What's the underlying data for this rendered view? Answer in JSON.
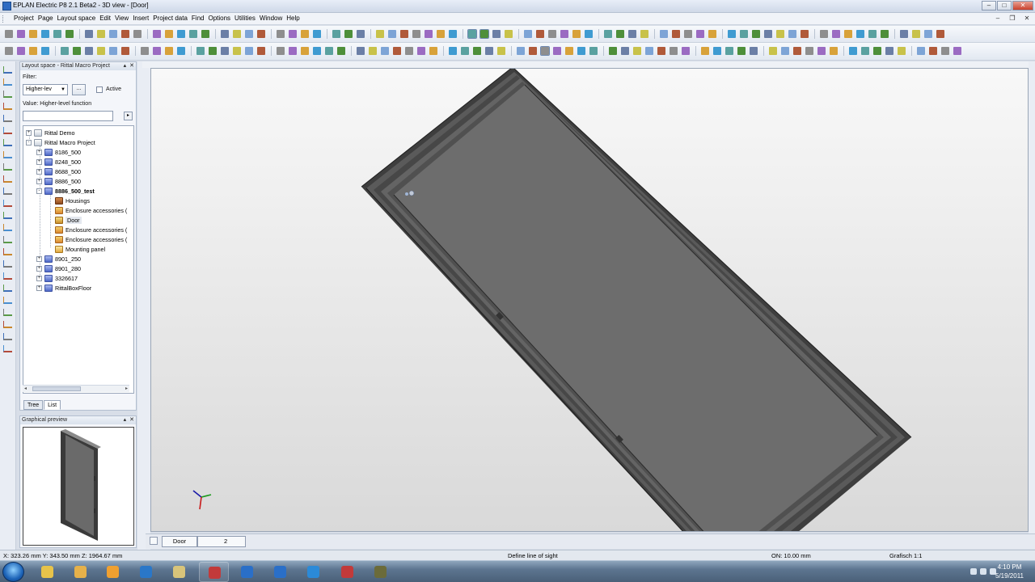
{
  "window": {
    "title": "EPLAN Electric P8 2.1 Beta2 - 3D view - [Door]"
  },
  "menu": [
    "Project",
    "Page",
    "Layout space",
    "Edit",
    "View",
    "Insert",
    "Project data",
    "Find",
    "Options",
    "Utilities",
    "Window",
    "Help"
  ],
  "layout_panel": {
    "title": "Layout space - Rittal Macro Project",
    "filter_label": "Filter:",
    "filter_value": "Higher-lev",
    "ellipsis_label": "...",
    "active_label": "Active",
    "value_label": "Value: Higher-level function",
    "tree": [
      {
        "label": "Rittal Demo",
        "level": 0,
        "icon": "project-icon",
        "expander": "+"
      },
      {
        "label": "Rittal Macro Project",
        "level": 0,
        "icon": "project-icon",
        "expander": "-"
      },
      {
        "label": "8186_500",
        "level": 1,
        "icon": "function-icon",
        "expander": "+"
      },
      {
        "label": "8248_500",
        "level": 1,
        "icon": "function-icon",
        "expander": "+"
      },
      {
        "label": "8688_500",
        "level": 1,
        "icon": "function-icon",
        "expander": "+"
      },
      {
        "label": "8886_500",
        "level": 1,
        "icon": "function-icon",
        "expander": "+"
      },
      {
        "label": "8886_500_test",
        "level": 1,
        "icon": "function-icon",
        "expander": "-",
        "bold": true
      },
      {
        "label": "Housings",
        "level": 2,
        "icon": "housing-icon"
      },
      {
        "label": "Enclosure accessories (",
        "level": 2,
        "icon": "accessory-icon"
      },
      {
        "label": "Door",
        "level": 2,
        "icon": "door-icon",
        "selected": true
      },
      {
        "label": "Enclosure accessories (",
        "level": 2,
        "icon": "accessory-icon"
      },
      {
        "label": "Enclosure accessories (",
        "level": 2,
        "icon": "accessory-icon"
      },
      {
        "label": "Mounting panel",
        "level": 2,
        "icon": "panel-icon"
      },
      {
        "label": "8901_250",
        "level": 1,
        "icon": "function-icon",
        "expander": "+"
      },
      {
        "label": "8901_280",
        "level": 1,
        "icon": "function-icon",
        "expander": "+"
      },
      {
        "label": "3326617",
        "level": 1,
        "icon": "function-icon",
        "expander": "+"
      },
      {
        "label": "RittalBoxFloor",
        "level": 1,
        "icon": "function-icon",
        "expander": "+"
      }
    ],
    "tabs": [
      "Tree",
      "List"
    ]
  },
  "preview_panel": {
    "title": "Graphical preview"
  },
  "page_tabs": [
    {
      "label": "Door",
      "active": true
    },
    {
      "label": "2",
      "active": false
    }
  ],
  "status": {
    "coords": "X: 323.26 mm   Y: 343.50 mm   Z: 1964.67 mm",
    "message": "Define line of sight",
    "grid": "ON: 10.00 mm",
    "scale": "Grafisch 1:1"
  },
  "taskbar": {
    "time": "4:10 PM",
    "date": "5/19/2011",
    "apps": [
      "start-button",
      "chrome-icon",
      "explorer-icon",
      "media-player-icon",
      "outlook-icon",
      "notepad-icon",
      "eplan-icon",
      "itunes-icon",
      "itunes-icon-2",
      "internet-explorer-icon",
      "eplan-icon-2",
      "tool-icon"
    ]
  },
  "colors": {
    "door_fill": "#6d6d6d",
    "door_frame": "#3c3c3c",
    "viewport_bg": "#ececec",
    "accent": "#2e6bc2"
  }
}
